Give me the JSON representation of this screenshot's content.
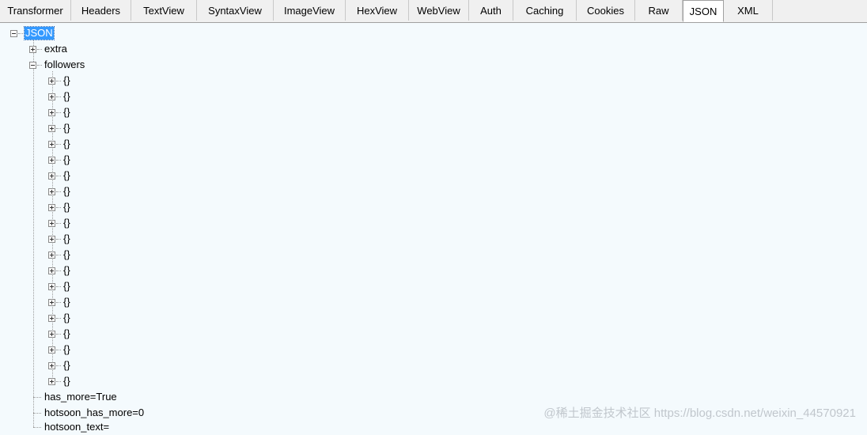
{
  "tabs": [
    {
      "label": "Transformer",
      "active": false
    },
    {
      "label": "Headers",
      "active": false
    },
    {
      "label": "TextView",
      "active": false
    },
    {
      "label": "SyntaxView",
      "active": false
    },
    {
      "label": "ImageView",
      "active": false
    },
    {
      "label": "HexView",
      "active": false
    },
    {
      "label": "WebView",
      "active": false
    },
    {
      "label": "Auth",
      "active": false
    },
    {
      "label": "Caching",
      "active": false
    },
    {
      "label": "Cookies",
      "active": false
    },
    {
      "label": "Raw",
      "active": false
    },
    {
      "label": "JSON",
      "active": true
    },
    {
      "label": "XML",
      "active": false
    }
  ],
  "tree": {
    "root": {
      "label": "JSON",
      "expanded": true,
      "selected": true
    },
    "children": [
      {
        "label": "extra",
        "expanded": false
      },
      {
        "label": "followers",
        "expanded": true,
        "item_label": "{}",
        "item_count": 20
      },
      {
        "label": "has_more=True"
      },
      {
        "label": "hotsoon_has_more=0"
      },
      {
        "label": "hotsoon_text="
      }
    ]
  },
  "watermark": "@稀土掘金技术社区 https://blog.csdn.net/weixin_44570921"
}
